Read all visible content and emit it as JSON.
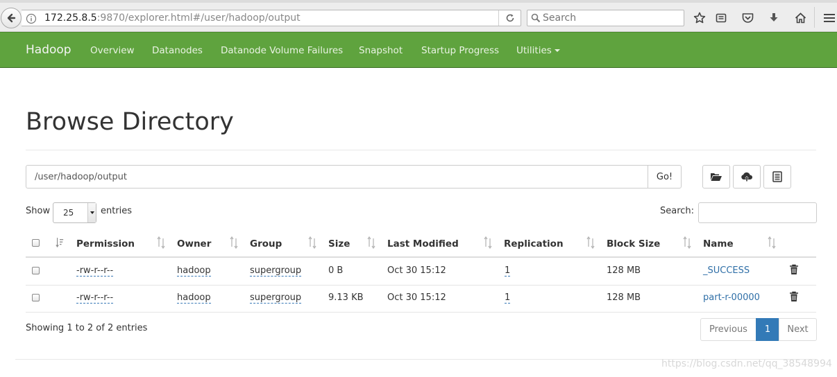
{
  "browser": {
    "url_host": "172.25.8.5",
    "url_rest": ":9870/explorer.html#/user/hadoop/output",
    "search_placeholder": "Search"
  },
  "navbar": {
    "brand": "Hadoop",
    "items": [
      "Overview",
      "Datanodes",
      "Datanode Volume Failures",
      "Snapshot",
      "Startup Progress",
      "Utilities"
    ]
  },
  "page": {
    "title": "Browse Directory",
    "path_value": "/user/hadoop/output",
    "go_label": "Go!",
    "show_label": "Show",
    "entries_value": "25",
    "entries_label": "entries",
    "search_label": "Search:"
  },
  "table": {
    "headers": [
      "Permission",
      "Owner",
      "Group",
      "Size",
      "Last Modified",
      "Replication",
      "Block Size",
      "Name"
    ],
    "rows": [
      {
        "permission": "-rw-r--r--",
        "owner": "hadoop",
        "group": "supergroup",
        "size": "0 B",
        "modified": "Oct 30 15:12",
        "replication": "1",
        "block_size": "128 MB",
        "name": "_SUCCESS"
      },
      {
        "permission": "-rw-r--r--",
        "owner": "hadoop",
        "group": "supergroup",
        "size": "9.13 KB",
        "modified": "Oct 30 15:12",
        "replication": "1",
        "block_size": "128 MB",
        "name": "part-r-00000"
      }
    ]
  },
  "footer": {
    "info": "Showing 1 to 2 of 2 entries",
    "prev_label": "Previous",
    "current_page": "1",
    "next_label": "Next",
    "watermark": "https://blog.csdn.net/qq_38548994"
  },
  "colors": {
    "navbar": "#5fa33e",
    "link": "#2f6fa7",
    "active_page": "#337ab7"
  }
}
